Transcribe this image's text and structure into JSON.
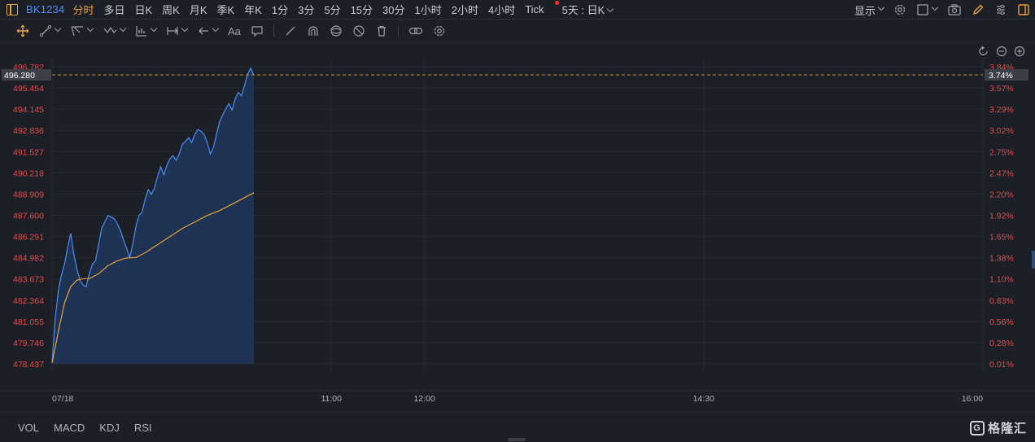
{
  "header": {
    "symbol": "BK1234",
    "periods": [
      {
        "label": "分时",
        "active": true
      },
      {
        "label": "多日"
      },
      {
        "label": "日K"
      },
      {
        "label": "周K"
      },
      {
        "label": "月K"
      },
      {
        "label": "季K"
      },
      {
        "label": "年K"
      },
      {
        "label": "1分"
      },
      {
        "label": "3分"
      },
      {
        "label": "5分"
      },
      {
        "label": "15分"
      },
      {
        "label": "30分"
      },
      {
        "label": "1小时"
      },
      {
        "label": "2小时"
      },
      {
        "label": "4小时"
      },
      {
        "label": "Tick",
        "dot": true
      }
    ],
    "range_select": "5天 : 日K",
    "display_label": "显示",
    "icons": [
      "settings-icon",
      "layout-box-icon",
      "camera-icon",
      "pencil-icon",
      "adjust-sliders-icon",
      "side-panel-icon"
    ]
  },
  "toolbar": {
    "tools": [
      "crosshair-move-icon",
      "trend-line-icon",
      "channel-icon",
      "pattern-icon",
      "measure-icon",
      "range-icon",
      "arrow-back-icon",
      "text-icon",
      "comment-icon",
      "eraser-icon",
      "magnet-icon",
      "visibility-icon",
      "lock-icon",
      "delete-icon",
      "link-icon",
      "settings-icon"
    ],
    "text_tool_label": "Aa"
  },
  "colors": {
    "price_line": "#4e8df5",
    "avg_line": "#e8a13a",
    "area_fill": "#1f3a63",
    "axis_text": "#e34a4a",
    "current_tag_bg": "#3a3f48",
    "grid": "#262a32",
    "accent": "#e8a13a"
  },
  "chart_data": {
    "type": "line",
    "y_left_ticks": [
      "496.782",
      "495.454",
      "494.145",
      "492.836",
      "491.527",
      "490.218",
      "488.909",
      "487.600",
      "486.291",
      "484.982",
      "483.673",
      "482.364",
      "481.055",
      "479.746",
      "478.437"
    ],
    "y_right_ticks": [
      "3.84%",
      "3.57%",
      "3.29%",
      "3.02%",
      "2.75%",
      "2.47%",
      "2.20%",
      "1.92%",
      "1.65%",
      "1.38%",
      "1.10%",
      "0.83%",
      "0.56%",
      "0.28%",
      "0.01%"
    ],
    "x_ticks": [
      {
        "label": "07/18",
        "t": 0
      },
      {
        "label": "11:00",
        "t": 90
      },
      {
        "label": "12:00",
        "t": 120
      },
      {
        "label": "14:30",
        "t": 210
      },
      {
        "label": "16:00",
        "t": 300
      }
    ],
    "x_range": [
      0,
      300
    ],
    "y_range": [
      478.437,
      496.782
    ],
    "current_price": "496.280",
    "current_pct": "3.74%",
    "price": [
      [
        0,
        478.5
      ],
      [
        1,
        481.2
      ],
      [
        2,
        482.9
      ],
      [
        3,
        483.9
      ],
      [
        4,
        484.6
      ],
      [
        5,
        485.6
      ],
      [
        6,
        486.5
      ],
      [
        7,
        485.2
      ],
      [
        8,
        484.3
      ],
      [
        9,
        483.6
      ],
      [
        10,
        483.3
      ],
      [
        11,
        483.2
      ],
      [
        12,
        484.0
      ],
      [
        13,
        484.6
      ],
      [
        14,
        484.8
      ],
      [
        15,
        485.8
      ],
      [
        16,
        486.8
      ],
      [
        17,
        487.2
      ],
      [
        18,
        487.6
      ],
      [
        19,
        487.5
      ],
      [
        20,
        487.4
      ],
      [
        21,
        487.1
      ],
      [
        22,
        486.7
      ],
      [
        23,
        486.1
      ],
      [
        24,
        485.6
      ],
      [
        25,
        485.0
      ],
      [
        26,
        485.8
      ],
      [
        27,
        486.9
      ],
      [
        28,
        487.6
      ],
      [
        29,
        487.8
      ],
      [
        30,
        488.6
      ],
      [
        31,
        489.2
      ],
      [
        32,
        488.9
      ],
      [
        33,
        489.3
      ],
      [
        34,
        490.0
      ],
      [
        35,
        490.6
      ],
      [
        36,
        490.1
      ],
      [
        37,
        490.7
      ],
      [
        38,
        491.1
      ],
      [
        39,
        491.3
      ],
      [
        40,
        491.0
      ],
      [
        41,
        491.4
      ],
      [
        42,
        492.0
      ],
      [
        43,
        492.2
      ],
      [
        44,
        492.4
      ],
      [
        45,
        492.1
      ],
      [
        46,
        492.6
      ],
      [
        47,
        492.9
      ],
      [
        48,
        492.8
      ],
      [
        49,
        492.6
      ],
      [
        50,
        492.1
      ],
      [
        51,
        491.4
      ],
      [
        52,
        491.8
      ],
      [
        53,
        492.6
      ],
      [
        54,
        493.4
      ],
      [
        55,
        493.8
      ],
      [
        56,
        494.2
      ],
      [
        57,
        494.5
      ],
      [
        58,
        494.1
      ],
      [
        59,
        494.8
      ],
      [
        60,
        495.2
      ],
      [
        61,
        495.0
      ],
      [
        62,
        495.6
      ],
      [
        63,
        496.3
      ],
      [
        64,
        496.7
      ],
      [
        65,
        496.28
      ]
    ],
    "avg": [
      [
        0,
        478.5
      ],
      [
        2,
        480.4
      ],
      [
        4,
        482.2
      ],
      [
        6,
        483.2
      ],
      [
        8,
        483.6
      ],
      [
        10,
        483.7
      ],
      [
        12,
        483.7
      ],
      [
        15,
        484.0
      ],
      [
        18,
        484.5
      ],
      [
        21,
        484.8
      ],
      [
        24,
        484.98
      ],
      [
        27,
        485.0
      ],
      [
        30,
        485.3
      ],
      [
        34,
        485.8
      ],
      [
        38,
        486.3
      ],
      [
        42,
        486.8
      ],
      [
        46,
        487.2
      ],
      [
        50,
        487.6
      ],
      [
        54,
        487.9
      ],
      [
        58,
        488.3
      ],
      [
        62,
        488.7
      ],
      [
        65,
        489.0
      ]
    ]
  },
  "bottom": {
    "indicators": [
      "VOL",
      "MACD",
      "KDJ",
      "RSI"
    ],
    "logo_text": "格隆汇",
    "logo_mark": "G"
  }
}
